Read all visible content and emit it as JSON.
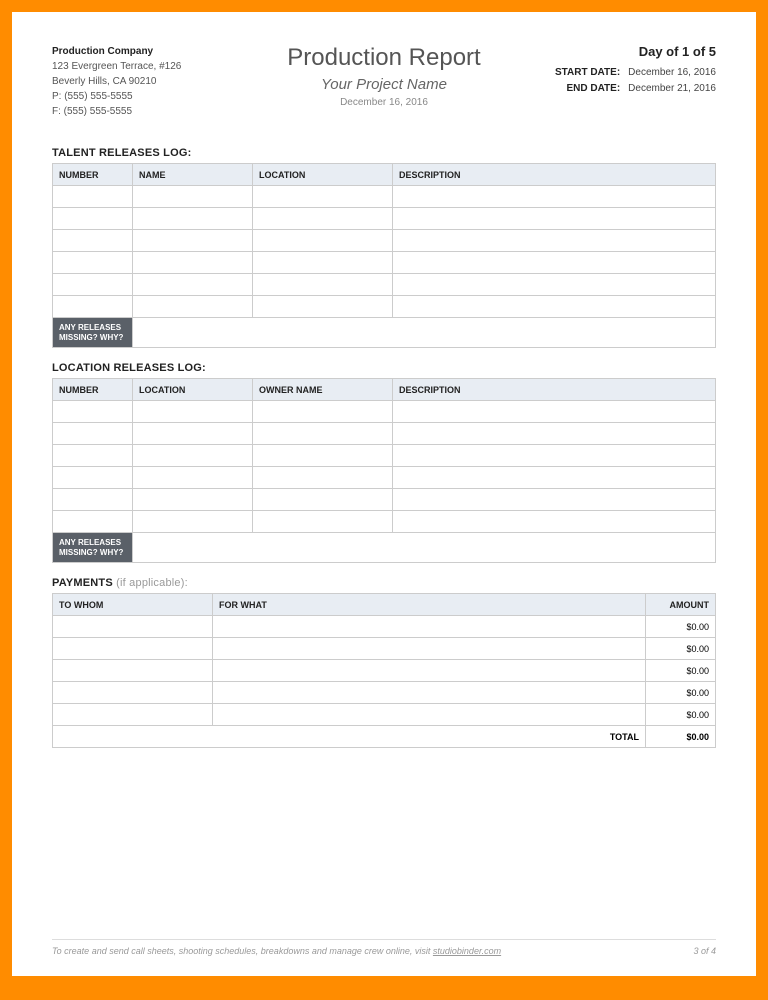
{
  "company": {
    "name": "Production Company",
    "address1": "123 Evergreen Terrace, #126",
    "address2": "Beverly Hills, CA 90210",
    "phone": "P: (555) 555-5555",
    "fax": "F: (555) 555-5555"
  },
  "title": {
    "main": "Production Report",
    "project": "Your Project Name",
    "date": "December 16, 2016"
  },
  "dates": {
    "day_of": "Day of 1 of 5",
    "start_label": "START DATE:",
    "start_value": "December 16, 2016",
    "end_label": "END DATE:",
    "end_value": "December 21, 2016"
  },
  "talent": {
    "section": "TALENT RELEASES LOG:",
    "headers": {
      "c1": "NUMBER",
      "c2": "NAME",
      "c3": "LOCATION",
      "c4": "DESCRIPTION"
    },
    "missing_label": "ANY RELEASES MISSING? WHY?"
  },
  "location": {
    "section": "LOCATION RELEASES LOG:",
    "headers": {
      "c1": "NUMBER",
      "c2": "LOCATION",
      "c3": "OWNER NAME",
      "c4": "DESCRIPTION"
    },
    "missing_label": "ANY RELEASES MISSING? WHY?"
  },
  "payments": {
    "section": "PAYMENTS",
    "hint": "  (if applicable):",
    "headers": {
      "c1": "TO WHOM",
      "c2": "FOR WHAT",
      "c3": "AMOUNT"
    },
    "rows": [
      {
        "amount": "$0.00"
      },
      {
        "amount": "$0.00"
      },
      {
        "amount": "$0.00"
      },
      {
        "amount": "$0.00"
      },
      {
        "amount": "$0.00"
      }
    ],
    "total_label": "TOTAL",
    "total_value": "$0.00"
  },
  "footer": {
    "text_pre": "To create and send call sheets, shooting schedules, breakdowns and manage crew online, visit ",
    "link": "studiobinder.com",
    "page": "3 of 4"
  }
}
